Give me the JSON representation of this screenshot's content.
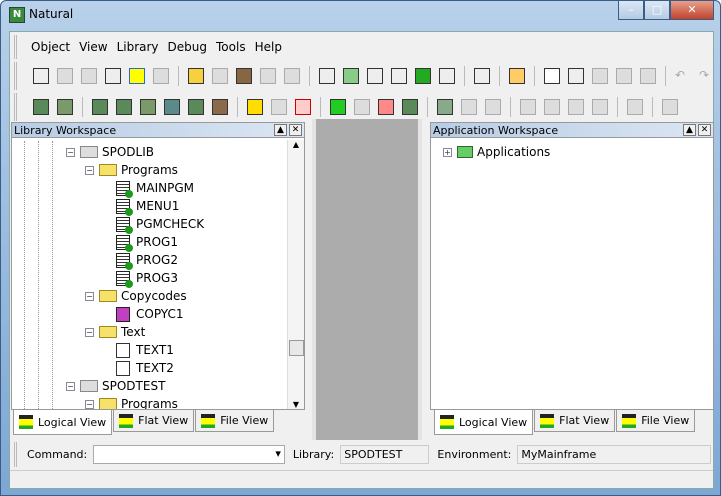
{
  "window": {
    "title": "Natural",
    "controls": [
      "minimize",
      "maximize",
      "close"
    ]
  },
  "menu": [
    "Object",
    "View",
    "Library",
    "Debug",
    "Tools",
    "Help"
  ],
  "library_workspace": {
    "title": "Library Workspace",
    "tree": [
      {
        "label": "SPODLIB",
        "type": "library",
        "level": 0,
        "expanded": true
      },
      {
        "label": "Programs",
        "type": "folder",
        "level": 1,
        "expanded": true
      },
      {
        "label": "MAINPGM",
        "type": "program",
        "level": 2
      },
      {
        "label": "MENU1",
        "type": "program",
        "level": 2
      },
      {
        "label": "PGMCHECK",
        "type": "program",
        "level": 2
      },
      {
        "label": "PROG1",
        "type": "program",
        "level": 2
      },
      {
        "label": "PROG2",
        "type": "program",
        "level": 2
      },
      {
        "label": "PROG3",
        "type": "program",
        "level": 2
      },
      {
        "label": "Copycodes",
        "type": "folder",
        "level": 1,
        "expanded": true
      },
      {
        "label": "COPYC1",
        "type": "copycode",
        "level": 2
      },
      {
        "label": "Text",
        "type": "folder",
        "level": 1,
        "expanded": true
      },
      {
        "label": "TEXT1",
        "type": "text",
        "level": 2
      },
      {
        "label": "TEXT2",
        "type": "text",
        "level": 2
      },
      {
        "label": "SPODTEST",
        "type": "library",
        "level": 0,
        "expanded": true
      },
      {
        "label": "Programs",
        "type": "folder",
        "level": 1,
        "expanded": true
      }
    ],
    "tabs": [
      "Logical View",
      "Flat View",
      "File View"
    ],
    "active_tab": 0
  },
  "application_workspace": {
    "title": "Application Workspace",
    "tree": [
      {
        "label": "Applications",
        "expanded": false
      }
    ],
    "tabs": [
      "Logical View",
      "Flat View",
      "File View"
    ],
    "active_tab": 0
  },
  "command_bar": {
    "command_label": "Command:",
    "command_value": "",
    "library_label": "Library:",
    "library_value": "SPODTEST",
    "environment_label": "Environment:",
    "environment_value": "MyMainframe"
  }
}
